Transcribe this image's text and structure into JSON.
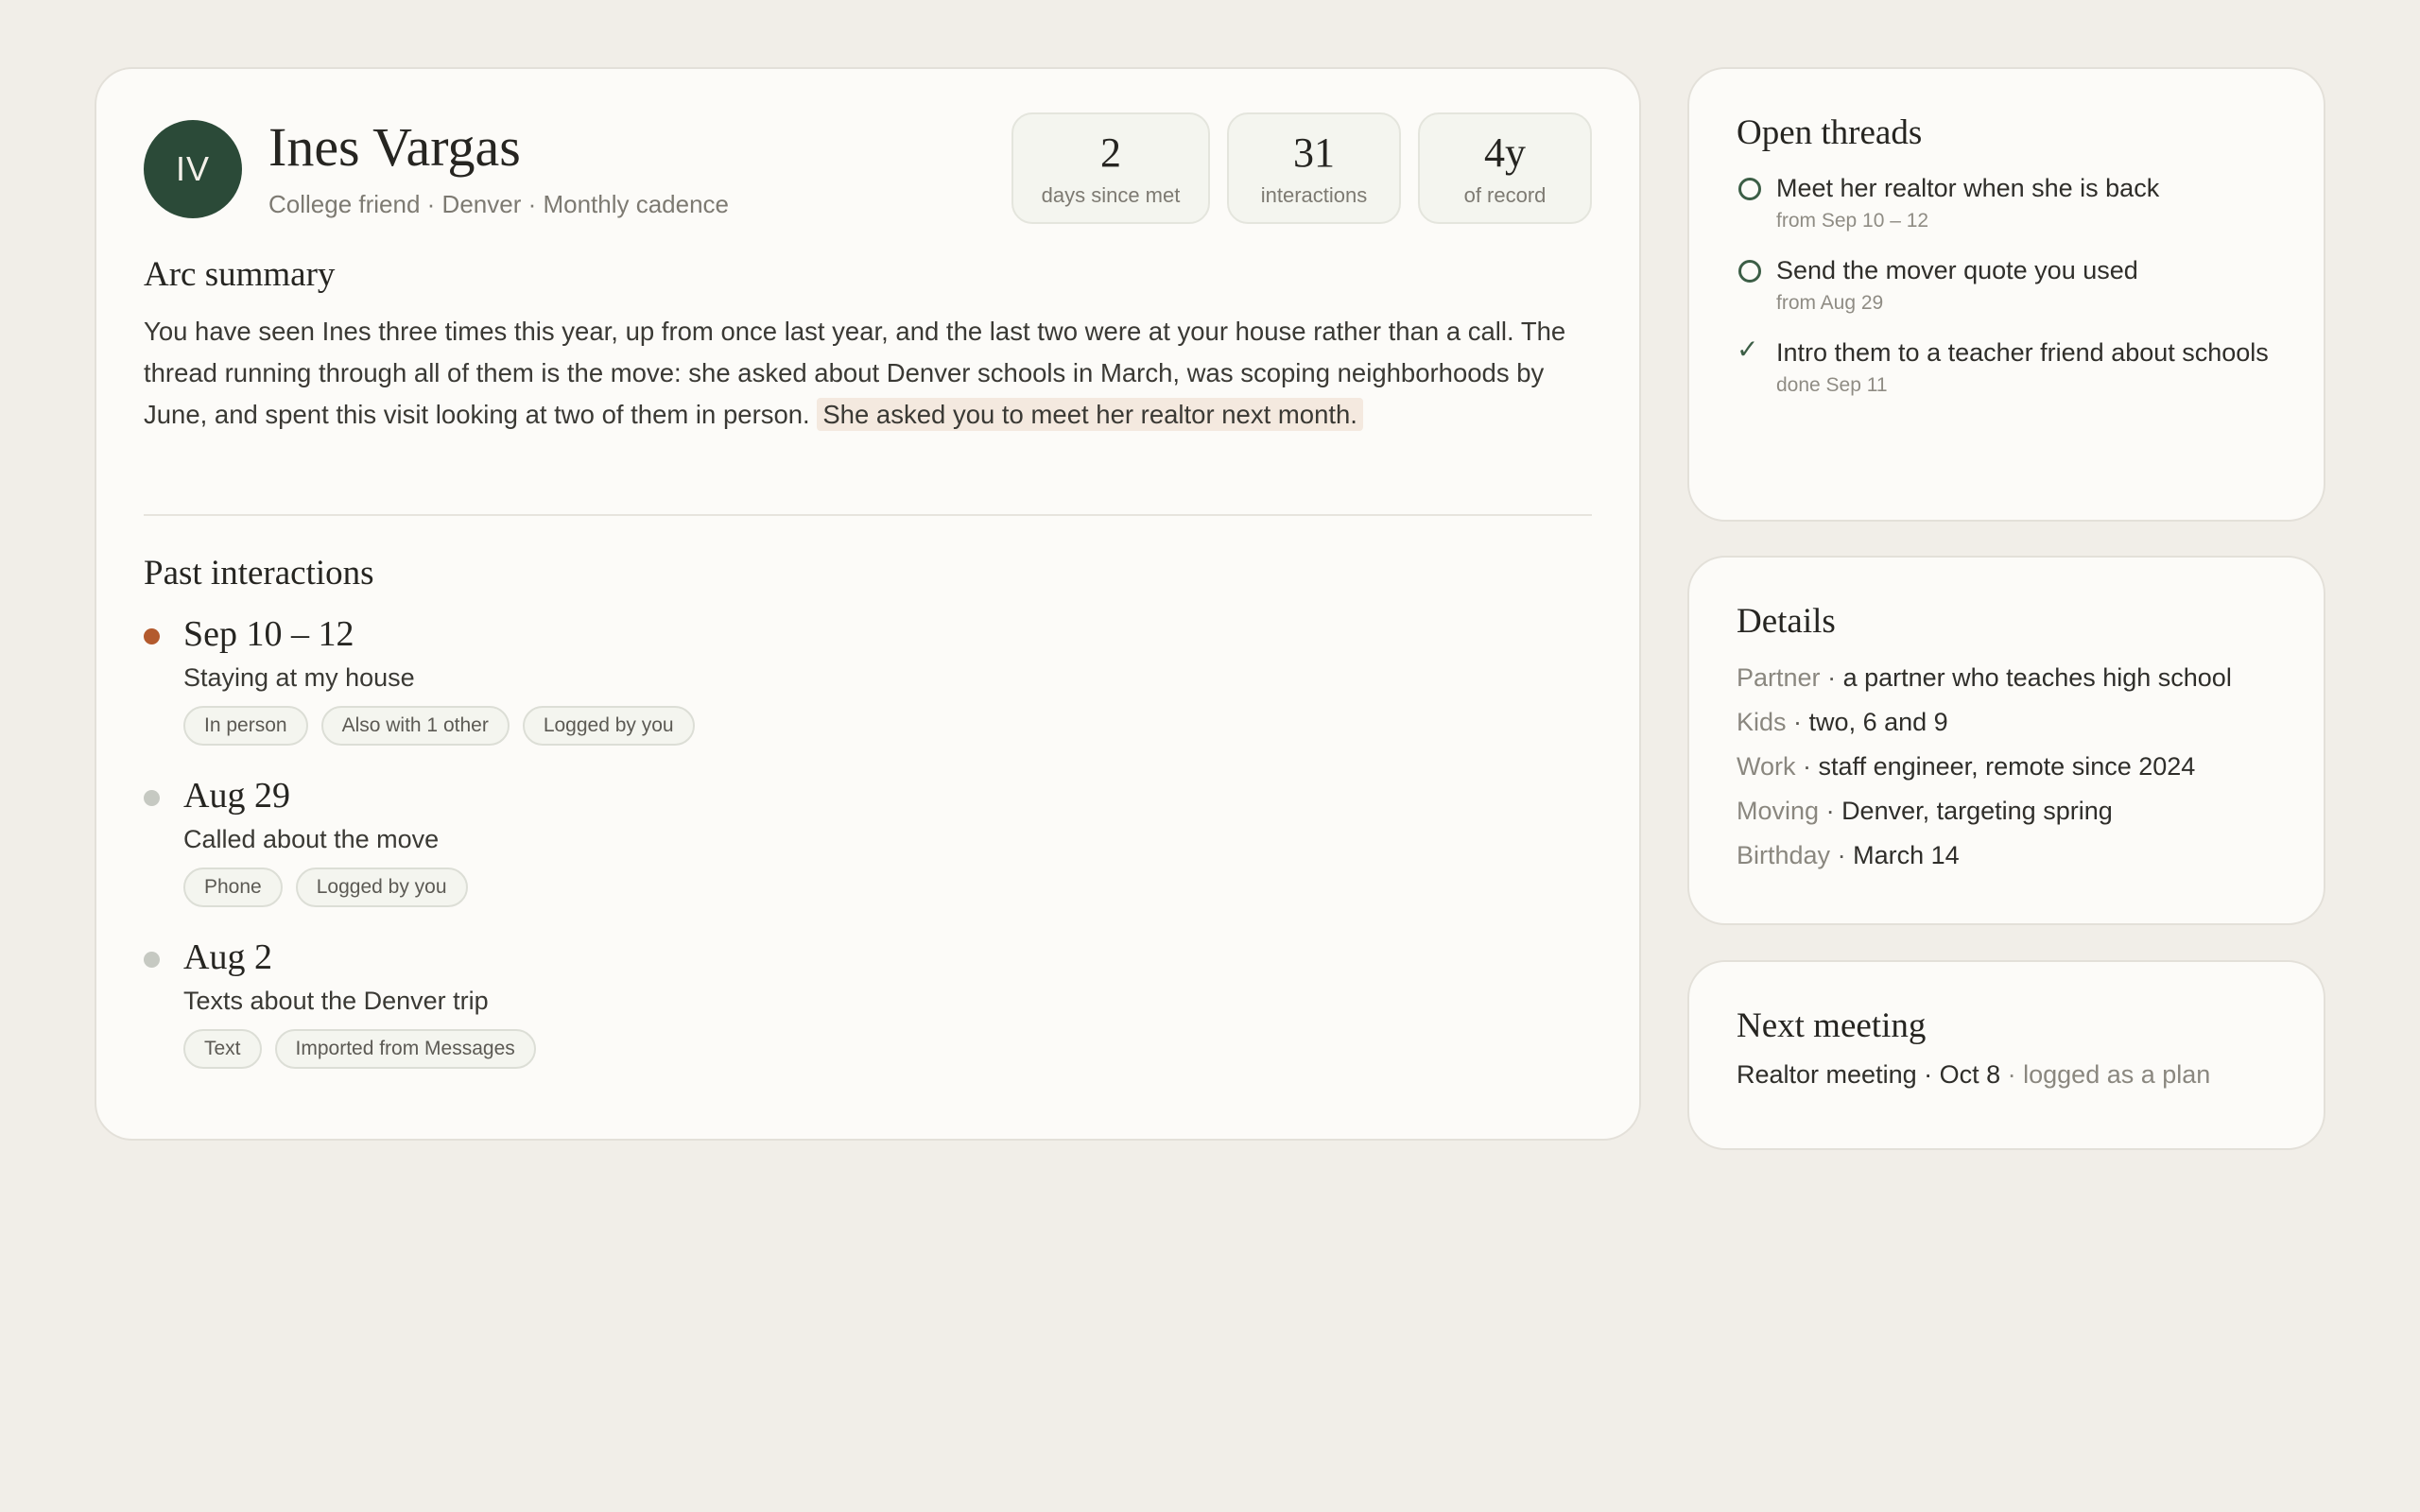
{
  "person": {
    "initials": "IV",
    "name": "Ines Vargas",
    "meta": "College friend · Denver · Monthly cadence"
  },
  "stats": [
    {
      "value": "2",
      "label": "days since met"
    },
    {
      "value": "31",
      "label": "interactions"
    },
    {
      "value": "4y",
      "label": "of record"
    }
  ],
  "arc": {
    "heading": "Arc summary",
    "text": "You have seen Ines three times this year, up from once last year, and the last two were at your house rather than a call. The thread running through all of them is the move: she asked about Denver schools in March, was scoping neighborhoods by June, and spent this visit looking at two of them in person.",
    "highlight": "She asked you to meet her realtor next month."
  },
  "past": {
    "heading": "Past interactions",
    "entries": [
      {
        "date": "Sep 10 – 12",
        "title": "Staying at my house",
        "tags": [
          "In person",
          "Also with 1 other",
          "Logged by you"
        ],
        "active": true
      },
      {
        "date": "Aug 29",
        "title": "Called about the move",
        "tags": [
          "Phone",
          "Logged by you"
        ],
        "active": false
      },
      {
        "date": "Aug 2",
        "title": "Texts about the Denver trip",
        "tags": [
          "Text",
          "Imported from Messages"
        ],
        "active": false
      }
    ]
  },
  "threads": {
    "heading": "Open threads",
    "items": [
      {
        "text": "Meet her realtor when she is back",
        "sub": "from Sep 10 – 12",
        "done": false
      },
      {
        "text": "Send the mover quote you used",
        "sub": "from Aug 29",
        "done": false
      },
      {
        "text": "Intro them to a teacher friend about schools",
        "sub": "done Sep 11",
        "done": true
      }
    ]
  },
  "details": {
    "heading": "Details",
    "rows": [
      {
        "key": "Partner",
        "value": "a partner who teaches high school"
      },
      {
        "key": "Kids",
        "value": "two, 6 and 9"
      },
      {
        "key": "Work",
        "value": "staff engineer, remote since 2024"
      },
      {
        "key": "Moving",
        "value": "Denver, targeting spring"
      },
      {
        "key": "Birthday",
        "value": "March 14"
      }
    ]
  },
  "meeting": {
    "heading": "Next meeting",
    "text": "Realtor meeting · Oct 8",
    "note": "· logged as a plan"
  },
  "icons": {
    "open_thread": "circle-outline-icon",
    "done_thread": "checkmark-icon",
    "timeline_dot": "dot-icon"
  },
  "colors": {
    "background": "#f1eee8",
    "card": "#fcfbf8",
    "avatar": "#2b4a38",
    "accent_dot": "#b35a2d",
    "muted_dot": "#c6c9c2",
    "highlight": "#f4e9df",
    "thread_green": "#3c5e46"
  }
}
